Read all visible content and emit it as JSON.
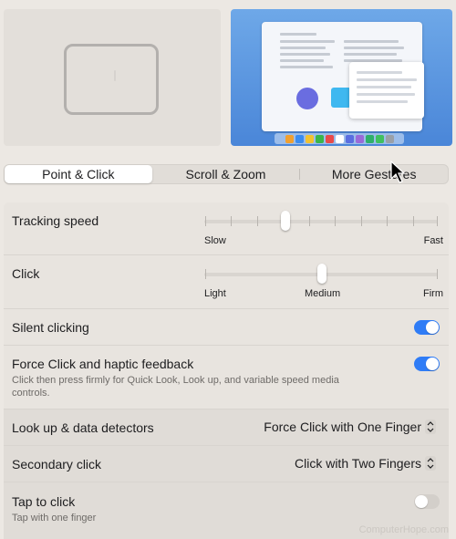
{
  "tabs": [
    {
      "label": "Point & Click",
      "active": true
    },
    {
      "label": "Scroll & Zoom",
      "active": false
    },
    {
      "label": "More Gestures",
      "active": false
    }
  ],
  "settings": {
    "tracking_speed": {
      "label": "Tracking speed",
      "min_label": "Slow",
      "max_label": "Fast",
      "value_fraction": 0.35
    },
    "click": {
      "label": "Click",
      "left_label": "Light",
      "middle_label": "Medium",
      "right_label": "Firm",
      "value": "Medium"
    },
    "silent_clicking": {
      "label": "Silent clicking",
      "enabled": true
    },
    "force_click": {
      "label": "Force Click and haptic feedback",
      "description": "Click then press firmly for Quick Look, Look up, and variable speed media controls.",
      "enabled": true
    },
    "look_up": {
      "label": "Look up & data detectors",
      "value": "Force Click with One Finger"
    },
    "secondary_click": {
      "label": "Secondary click",
      "value": "Click with Two Fingers"
    },
    "tap_to_click": {
      "label": "Tap to click",
      "description": "Tap with one finger",
      "enabled": false
    }
  },
  "watermark": "ComputerHope.com",
  "colors": {
    "accent": "#2f7cf6",
    "toggle_off": "#d3cfca",
    "background": "#ece8e3"
  },
  "icons": [
    "trackpad-preview",
    "pointer-cursor-icon",
    "chevron-updown-icon"
  ]
}
